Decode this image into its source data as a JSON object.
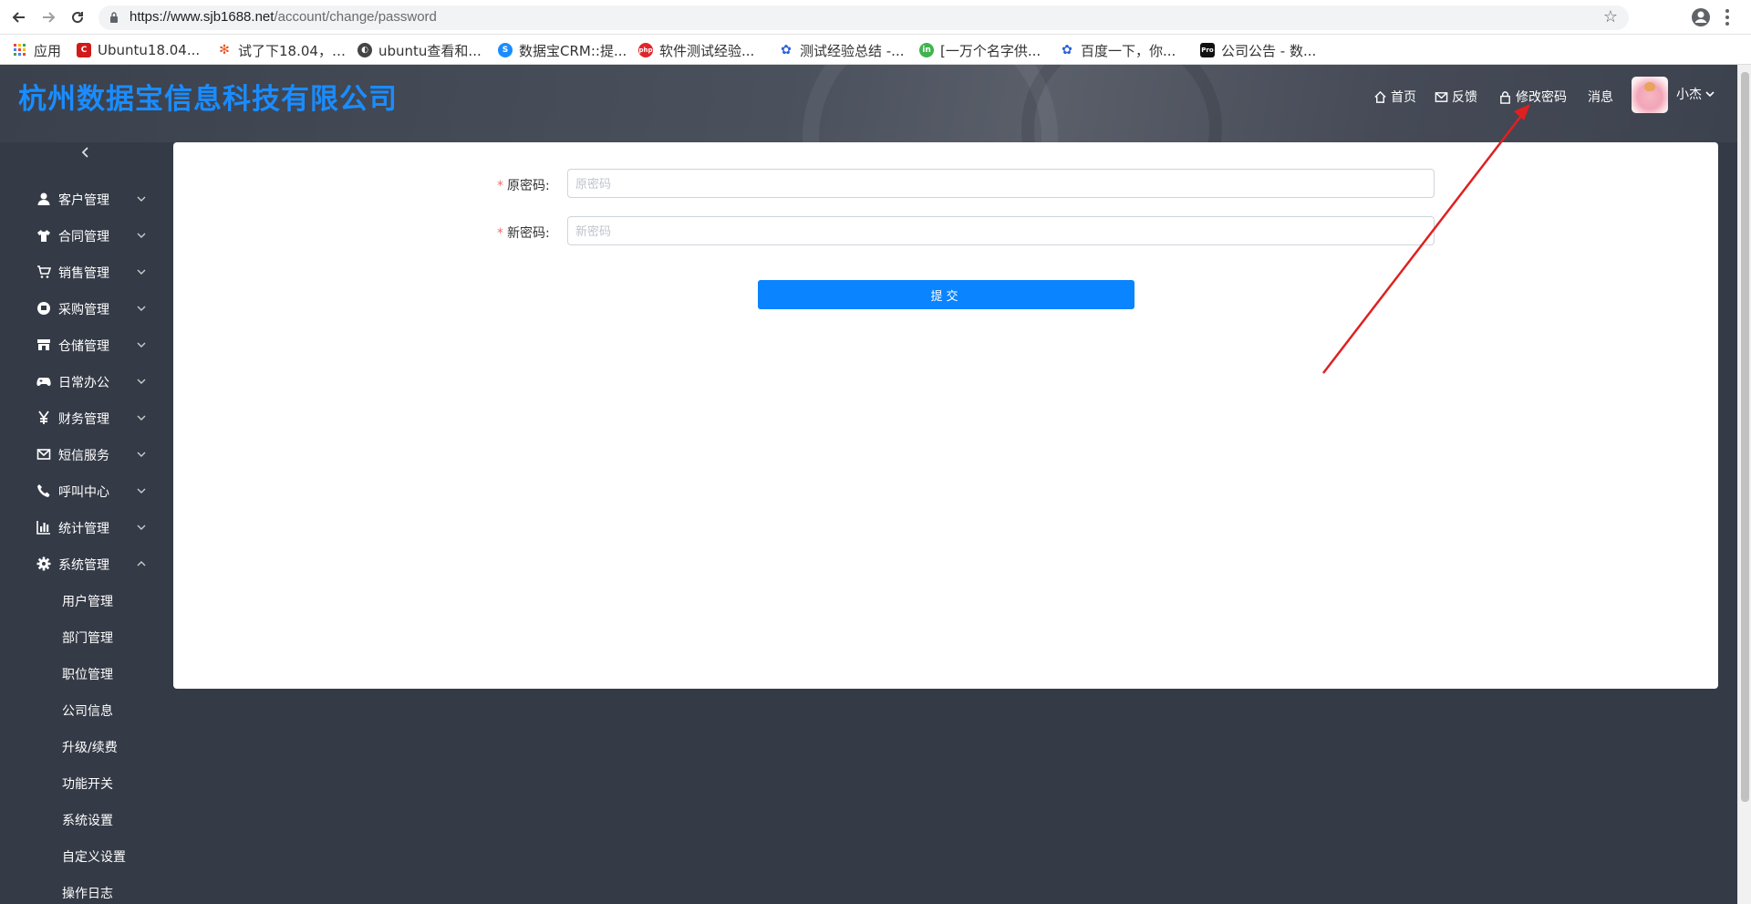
{
  "browser": {
    "url_host": "https://www.sjb1688.net",
    "url_path": "/account/change/password",
    "bookmarks": [
      {
        "label": "应用",
        "icon": "apps-grid-icon",
        "color": "#e8453c"
      },
      {
        "label": "Ubuntu18.04...",
        "icon": "c-logo-icon",
        "color": "#d11a1a"
      },
      {
        "label": "试了下18.04，…",
        "icon": "ubuntu-icon",
        "color": "#e95420"
      },
      {
        "label": "ubuntu查看和...",
        "icon": "ubuntu-circle-icon",
        "color": "#444444"
      },
      {
        "label": "数据宝CRM::提...",
        "icon": "crm-icon",
        "color": "#1a8cff"
      },
      {
        "label": "软件测试经验...",
        "icon": "php-icon",
        "color": "#e0262b"
      },
      {
        "label": "测试经验总结 -...",
        "icon": "paw-icon",
        "color": "#2a5fd8"
      },
      {
        "label": "[一万个名字供...",
        "icon": "green-circle-icon",
        "color": "#3fb34f"
      },
      {
        "label": "百度一下，你...",
        "icon": "paw-icon",
        "color": "#2a5fd8"
      },
      {
        "label": "公司公告 - 数...",
        "icon": "pro-icon",
        "color": "#111111"
      }
    ]
  },
  "header": {
    "company": "杭州数据宝信息科技有限公司",
    "nav": {
      "home": "首页",
      "feedback": "反馈",
      "change_password": "修改密码",
      "messages": "消息",
      "user": "小杰"
    }
  },
  "sidebar": {
    "items": [
      {
        "label": "客户管理",
        "icon": "user-icon"
      },
      {
        "label": "合同管理",
        "icon": "shirt-icon"
      },
      {
        "label": "销售管理",
        "icon": "cart-icon"
      },
      {
        "label": "采购管理",
        "icon": "purchase-icon"
      },
      {
        "label": "仓储管理",
        "icon": "store-icon"
      },
      {
        "label": "日常办公",
        "icon": "gamepad-icon"
      },
      {
        "label": "财务管理",
        "icon": "yen-icon"
      },
      {
        "label": "短信服务",
        "icon": "mail-icon"
      },
      {
        "label": "呼叫中心",
        "icon": "phone-icon"
      },
      {
        "label": "统计管理",
        "icon": "bar-chart-icon"
      },
      {
        "label": "系统管理",
        "icon": "gear-icon"
      }
    ],
    "sub_items": [
      "用户管理",
      "部门管理",
      "职位管理",
      "公司信息",
      "升级/续费",
      "功能开关",
      "系统设置",
      "自定义设置",
      "操作日志"
    ]
  },
  "form": {
    "old_password_label": "原密码:",
    "old_password_placeholder": "原密码",
    "old_password_value": "",
    "new_password_label": "新密码:",
    "new_password_placeholder": "新密码",
    "new_password_value": "",
    "submit_label": "提交"
  },
  "colors": {
    "accent": "#0a84ff",
    "company_title": "#1a8cff",
    "sidebar_bg": "#343a46",
    "annotation_arrow": "#e02020",
    "required_star": "#f56c6c"
  }
}
